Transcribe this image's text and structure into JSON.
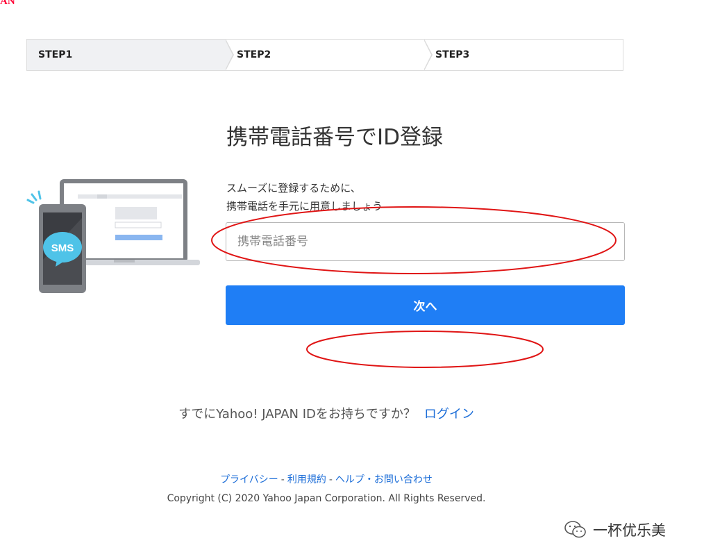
{
  "header": {
    "logo_fragment": "AN"
  },
  "steps": [
    {
      "label": "STEP1",
      "active": true
    },
    {
      "label": "STEP2",
      "active": false
    },
    {
      "label": "STEP3",
      "active": false
    }
  ],
  "main": {
    "title": "携帯電話番号でID登録",
    "description_line1": "スムーズに登録するために、",
    "description_line2": "携帯電話を手元に用意しましょう",
    "phone_input": {
      "placeholder": "携帯電話番号",
      "value": ""
    },
    "next_button_label": "次へ",
    "illustration": {
      "badge_text": "SMS"
    }
  },
  "login": {
    "prompt": "すでにYahoo! JAPAN IDをお持ちですか？",
    "link_label": "ログイン"
  },
  "footer": {
    "links": [
      {
        "label": "プライバシー"
      },
      {
        "label": "利用規約"
      },
      {
        "label": "ヘルプ・お問い合わせ"
      }
    ],
    "separator": "-",
    "copyright": "Copyright (C) 2020 Yahoo Japan Corporation. All Rights Reserved."
  },
  "watermark": {
    "text": "一杯优乐美"
  },
  "colors": {
    "primary_button": "#1f7ef5",
    "link": "#1d6ed8",
    "annotation": "#e01515",
    "brand_red": "#ff0033",
    "sms_badge": "#4fc3e8"
  }
}
